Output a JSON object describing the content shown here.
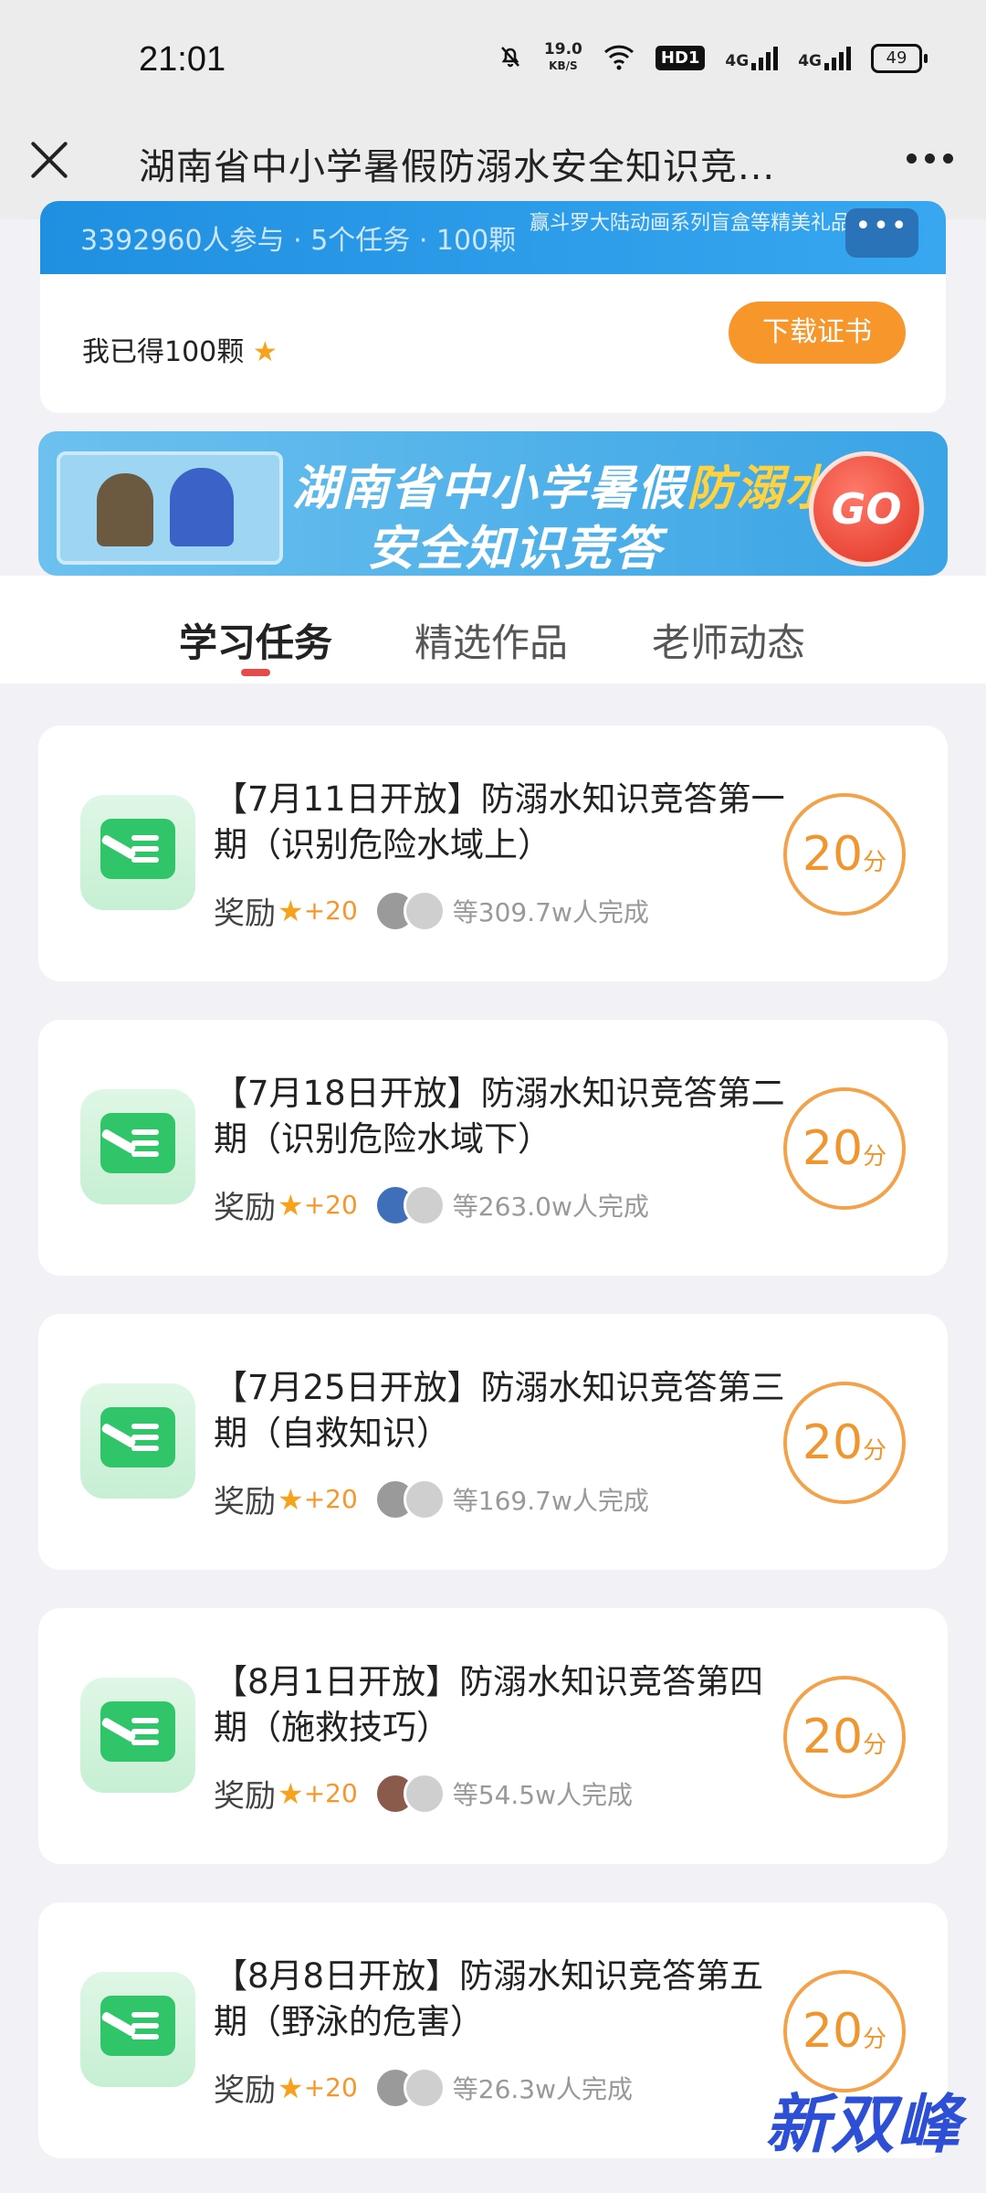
{
  "status_bar": {
    "time": "21:01",
    "net_speed": "19.0",
    "net_unit": "KB/S",
    "hd": "HD1",
    "sig1": "4G",
    "sig2": "4G",
    "battery": "49",
    "icons": [
      "mute-bell-icon",
      "wifi-icon",
      "signal-icon",
      "battery-icon"
    ]
  },
  "nav": {
    "title": "湖南省中小学暑假防溺水安全知识竞...",
    "close_icon": "close-icon",
    "more_icon": "more-icon"
  },
  "summary": {
    "stats": "3392960人参与 · 5个任务 · 100颗",
    "promo": "赢斗罗大陆动画系列盲盒等精美礼品",
    "more": "•••",
    "earned": "我已得100颗",
    "download_label": "下载证书"
  },
  "banner": {
    "line1_a": "湖南省中小学暑假",
    "line1_b": "防溺水",
    "line2": "安全知识竞答",
    "go": "GO"
  },
  "tabs": [
    {
      "label": "学习任务",
      "active": true
    },
    {
      "label": "精选作品",
      "active": false
    },
    {
      "label": "老师动态",
      "active": false
    }
  ],
  "tasks": [
    {
      "title": "【7月11日开放】防溺水知识竞答第一期（识别危险水域上）",
      "reward_label": "奖励",
      "reward_value": "+20",
      "completed": "等309.7w人完成",
      "score": "20",
      "unit": "分"
    },
    {
      "title": "【7月18日开放】防溺水知识竞答第二期（识别危险水域下）",
      "reward_label": "奖励",
      "reward_value": "+20",
      "completed": "等263.0w人完成",
      "score": "20",
      "unit": "分"
    },
    {
      "title": "【7月25日开放】防溺水知识竞答第三期（自救知识）",
      "reward_label": "奖励",
      "reward_value": "+20",
      "completed": "等169.7w人完成",
      "score": "20",
      "unit": "分"
    },
    {
      "title": "【8月1日开放】防溺水知识竞答第四期（施救技巧）",
      "reward_label": "奖励",
      "reward_value": "+20",
      "completed": "等54.5w人完成",
      "score": "20",
      "unit": "分"
    },
    {
      "title": "【8月8日开放】防溺水知识竞答第五期（野泳的危害）",
      "reward_label": "奖励",
      "reward_value": "+20",
      "completed": "等26.3w人完成",
      "score": "20",
      "unit": "分"
    }
  ],
  "watermark": "新双峰",
  "colors": {
    "accent": "#f7962a",
    "banner_blue": "#3aa4e5",
    "tab_indicator": "#e54b4b",
    "icon_green": "#31c56a"
  }
}
